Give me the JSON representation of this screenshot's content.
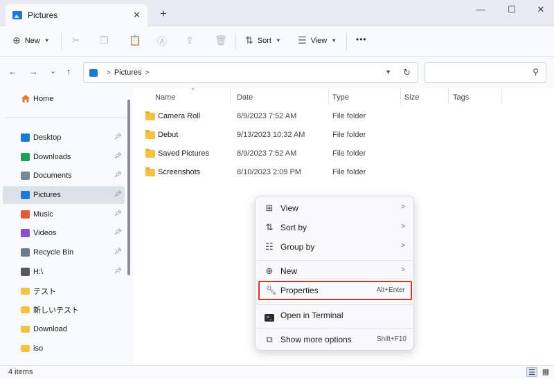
{
  "tab": {
    "title": "Pictures",
    "close": "✕",
    "add": "+"
  },
  "window": {
    "minimize": "—",
    "maximize": "☐",
    "close": "✕"
  },
  "toolbar": {
    "new_label": "New",
    "sort_label": "Sort",
    "view_label": "View",
    "more": "•••"
  },
  "nav": {
    "back": "←",
    "forward": "→",
    "recent": "⌄",
    "up": "↑"
  },
  "address": {
    "path": "Pictures",
    "sep": ">",
    "refresh": "↻"
  },
  "search": {
    "placeholder": ""
  },
  "sidebar": {
    "home": "Home",
    "items": [
      {
        "label": "Desktop",
        "icon": "desktop-icon",
        "color": "#1c79d6"
      },
      {
        "label": "Downloads",
        "icon": "download-icon",
        "color": "#1f9e5a"
      },
      {
        "label": "Documents",
        "icon": "document-icon",
        "color": "#7c8794"
      },
      {
        "label": "Pictures",
        "icon": "pictures-icon",
        "color": "#1c79d6"
      },
      {
        "label": "Music",
        "icon": "music-icon",
        "color": "#e05a3a"
      },
      {
        "label": "Videos",
        "icon": "video-icon",
        "color": "#8a4fd6"
      },
      {
        "label": "Recycle Bin",
        "icon": "recycle-bin-icon",
        "color": "#6b7b8c"
      },
      {
        "label": "H:\\",
        "icon": "drive-icon",
        "color": "#5a5a5a"
      },
      {
        "label": "テスト",
        "icon": "folder-icon",
        "color": "#f3c243"
      },
      {
        "label": "新しいテスト",
        "icon": "folder-icon",
        "color": "#f3c243"
      },
      {
        "label": "Download",
        "icon": "folder-icon",
        "color": "#f3c243"
      },
      {
        "label": "iso",
        "icon": "folder-icon",
        "color": "#f3c243"
      }
    ]
  },
  "columns": {
    "name": "Name",
    "date": "Date",
    "type": "Type",
    "size": "Size",
    "tags": "Tags"
  },
  "files": [
    {
      "name": "Camera Roll",
      "date": "8/9/2023 7:52 AM",
      "type": "File folder"
    },
    {
      "name": "Debut",
      "date": "9/13/2023 10:32 AM",
      "type": "File folder"
    },
    {
      "name": "Saved Pictures",
      "date": "8/9/2023 7:52 AM",
      "type": "File folder"
    },
    {
      "name": "Screenshots",
      "date": "8/10/2023 2:09 PM",
      "type": "File folder"
    }
  ],
  "status": {
    "count": "4 items"
  },
  "context_menu": {
    "view": "View",
    "sort_by": "Sort by",
    "group_by": "Group by",
    "new": "New",
    "properties": "Properties",
    "properties_shortcut": "Alt+Enter",
    "terminal": "Open in Terminal",
    "more_options": "Show more options",
    "more_options_shortcut": "Shift+F10",
    "arrow": ">"
  },
  "colors": {
    "accent": "#1c79d6",
    "highlight_border": "#e0301e",
    "folder": "#f3c243"
  }
}
